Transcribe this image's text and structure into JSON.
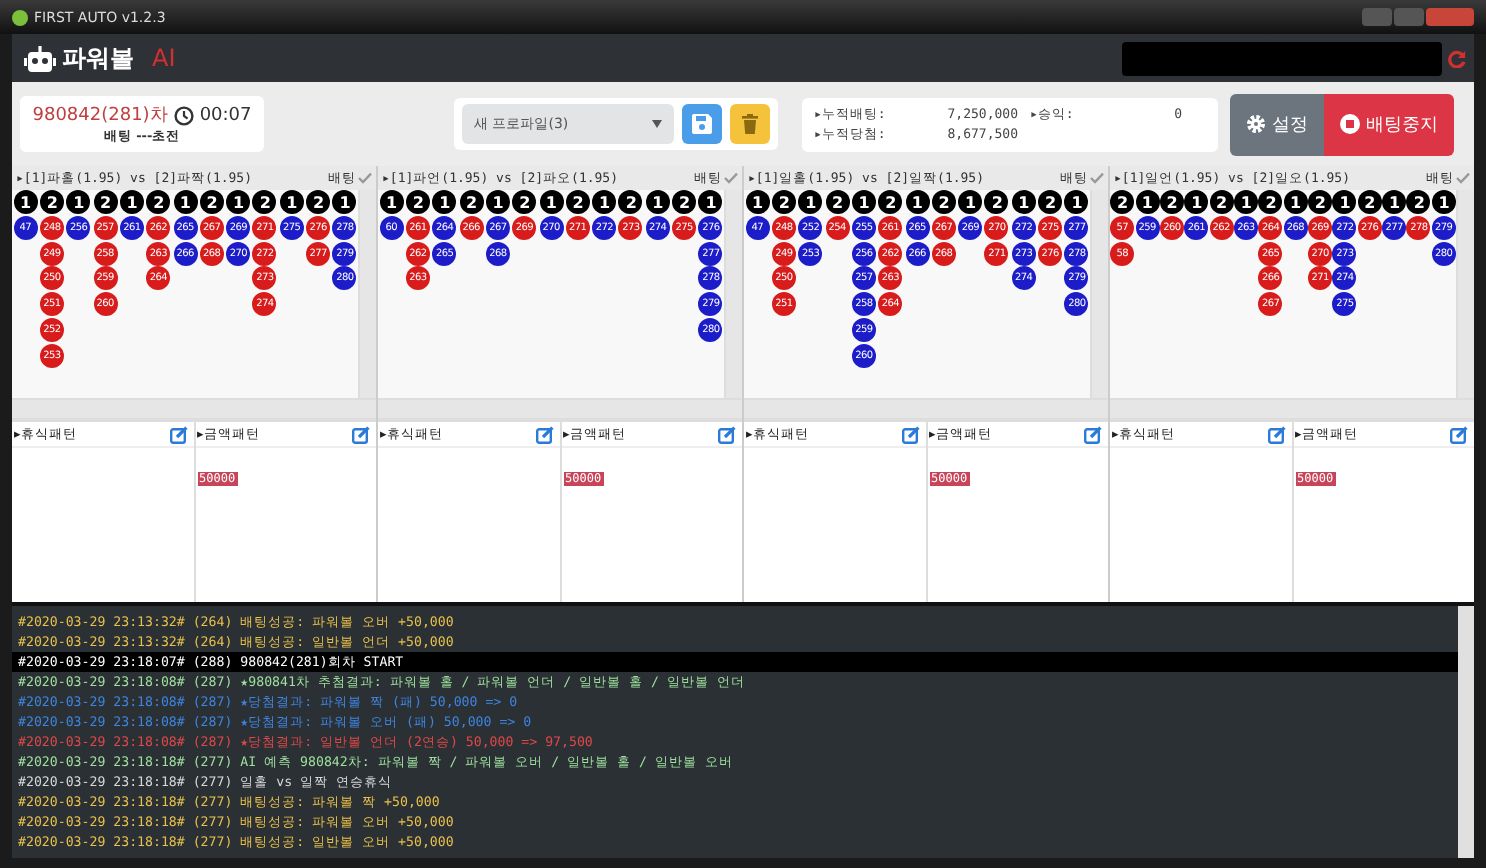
{
  "window": {
    "title": "FIRST AUTO v1.2.3"
  },
  "app": {
    "name": "파워볼",
    "badge": "AI"
  },
  "round": {
    "label": "980842(281)차",
    "timer": "00:07",
    "status": "배팅 ---초전"
  },
  "profile": {
    "value": "새 프로파일(3)"
  },
  "stats": [
    {
      "label": "▸누적배팅:",
      "value": "7,250,000"
    },
    {
      "label": "▸승익:",
      "value": "0"
    },
    {
      "label": "▸누적당첨:",
      "value": "8,677,500"
    }
  ],
  "buttons": [
    {
      "label": "설정",
      "kind": "settings"
    },
    {
      "label": "배팅중지",
      "kind": "stop"
    }
  ],
  "boards": [
    {
      "title": "▸[1]파홀(1.95) vs [2]파짝(1.95)",
      "bet": "배팅",
      "checked": true,
      "columns": [
        {
          "head": "1",
          "color": "#1c1cc8",
          "balls": [
            "47"
          ]
        },
        {
          "head": "2",
          "color": "#d81c1c",
          "balls": [
            "248",
            "249",
            "250",
            "251",
            "252",
            "253"
          ]
        },
        {
          "head": "1",
          "color": "#1c1cc8",
          "balls": [
            "256"
          ]
        },
        {
          "head": "2",
          "color": "#d81c1c",
          "balls": [
            "257",
            "258",
            "259",
            "260"
          ]
        },
        {
          "head": "1",
          "color": "#1c1cc8",
          "balls": [
            "261"
          ]
        },
        {
          "head": "2",
          "color": "#d81c1c",
          "balls": [
            "262",
            "263",
            "264"
          ]
        },
        {
          "head": "1",
          "color": "#1c1cc8",
          "balls": [
            "265",
            "266"
          ]
        },
        {
          "head": "2",
          "color": "#d81c1c",
          "balls": [
            "267",
            "268"
          ]
        },
        {
          "head": "1",
          "color": "#1c1cc8",
          "balls": [
            "269",
            "270"
          ]
        },
        {
          "head": "2",
          "color": "#d81c1c",
          "balls": [
            "271",
            "272",
            "273",
            "274"
          ]
        },
        {
          "head": "1",
          "color": "#1c1cc8",
          "balls": [
            "275"
          ]
        },
        {
          "head": "2",
          "color": "#d81c1c",
          "balls": [
            "276",
            "277"
          ]
        },
        {
          "head": "1",
          "color": "#1c1cc8",
          "balls": [
            "278",
            "279",
            "280"
          ]
        }
      ]
    },
    {
      "title": "▸[1]파언(1.95) vs [2]파오(1.95)",
      "bet": "배팅",
      "checked": true,
      "columns": [
        {
          "head": "1",
          "color": "#1c1cc8",
          "balls": [
            "60"
          ]
        },
        {
          "head": "2",
          "color": "#d81c1c",
          "balls": [
            "261",
            "262",
            "263"
          ]
        },
        {
          "head": "1",
          "color": "#1c1cc8",
          "balls": [
            "264",
            "265"
          ]
        },
        {
          "head": "2",
          "color": "#d81c1c",
          "balls": [
            "266"
          ]
        },
        {
          "head": "1",
          "color": "#1c1cc8",
          "balls": [
            "267",
            "268"
          ]
        },
        {
          "head": "2",
          "color": "#d81c1c",
          "balls": [
            "269"
          ]
        },
        {
          "head": "1",
          "color": "#1c1cc8",
          "balls": [
            "270"
          ]
        },
        {
          "head": "2",
          "color": "#d81c1c",
          "balls": [
            "271"
          ]
        },
        {
          "head": "1",
          "color": "#1c1cc8",
          "balls": [
            "272"
          ]
        },
        {
          "head": "2",
          "color": "#d81c1c",
          "balls": [
            "273"
          ]
        },
        {
          "head": "1",
          "color": "#1c1cc8",
          "balls": [
            "274"
          ]
        },
        {
          "head": "2",
          "color": "#d81c1c",
          "balls": [
            "275"
          ]
        },
        {
          "head": "1",
          "color": "#1c1cc8",
          "balls": [
            "276",
            "277",
            "278",
            "279",
            "280"
          ]
        }
      ]
    },
    {
      "title": "▸[1]일홀(1.95) vs [2]일짝(1.95)",
      "bet": "배팅",
      "checked": true,
      "columns": [
        {
          "head": "1",
          "color": "#1c1cc8",
          "balls": [
            "47"
          ]
        },
        {
          "head": "2",
          "color": "#d81c1c",
          "balls": [
            "248",
            "249",
            "250",
            "251"
          ]
        },
        {
          "head": "1",
          "color": "#1c1cc8",
          "balls": [
            "252",
            "253"
          ]
        },
        {
          "head": "2",
          "color": "#d81c1c",
          "balls": [
            "254"
          ]
        },
        {
          "head": "1",
          "color": "#1c1cc8",
          "balls": [
            "255",
            "256",
            "257",
            "258",
            "259",
            "260"
          ]
        },
        {
          "head": "2",
          "color": "#d81c1c",
          "balls": [
            "261",
            "262",
            "263",
            "264"
          ]
        },
        {
          "head": "1",
          "color": "#1c1cc8",
          "balls": [
            "265",
            "266"
          ]
        },
        {
          "head": "2",
          "color": "#d81c1c",
          "balls": [
            "267",
            "268"
          ]
        },
        {
          "head": "1",
          "color": "#1c1cc8",
          "balls": [
            "269"
          ]
        },
        {
          "head": "2",
          "color": "#d81c1c",
          "balls": [
            "270",
            "271"
          ]
        },
        {
          "head": "1",
          "color": "#1c1cc8",
          "balls": [
            "272",
            "273",
            "274"
          ]
        },
        {
          "head": "2",
          "color": "#d81c1c",
          "balls": [
            "275",
            "276"
          ]
        },
        {
          "head": "1",
          "color": "#1c1cc8",
          "balls": [
            "277",
            "278",
            "279",
            "280"
          ]
        }
      ]
    },
    {
      "title": "▸[1]일언(1.95) vs [2]일오(1.95)",
      "bet": "배팅",
      "checked": true,
      "columns": [
        {
          "head": "2",
          "color": "#d81c1c",
          "balls": [
            "57",
            "58"
          ]
        },
        {
          "head": "1",
          "color": "#1c1cc8",
          "balls": [
            "259"
          ]
        },
        {
          "head": "2",
          "color": "#d81c1c",
          "balls": [
            "260"
          ]
        },
        {
          "head": "1",
          "color": "#1c1cc8",
          "balls": [
            "261"
          ]
        },
        {
          "head": "2",
          "color": "#d81c1c",
          "balls": [
            "262"
          ]
        },
        {
          "head": "1",
          "color": "#1c1cc8",
          "balls": [
            "263"
          ]
        },
        {
          "head": "2",
          "color": "#d81c1c",
          "balls": [
            "264",
            "265",
            "266",
            "267"
          ]
        },
        {
          "head": "1",
          "color": "#1c1cc8",
          "balls": [
            "268"
          ]
        },
        {
          "head": "2",
          "color": "#d81c1c",
          "balls": [
            "269",
            "270",
            "271"
          ]
        },
        {
          "head": "1",
          "color": "#1c1cc8",
          "balls": [
            "272",
            "273",
            "274",
            "275"
          ]
        },
        {
          "head": "2",
          "color": "#d81c1c",
          "balls": [
            "276"
          ]
        },
        {
          "head": "1",
          "color": "#1c1cc8",
          "balls": [
            "277"
          ]
        },
        {
          "head": "2",
          "color": "#d81c1c",
          "balls": [
            "278"
          ]
        },
        {
          "head": "1",
          "color": "#1c1cc8",
          "balls": [
            "279",
            "280"
          ]
        }
      ]
    }
  ],
  "patterns": [
    {
      "rest": "▸휴식패턴",
      "amount": "▸금액패턴",
      "tags": [
        "50000"
      ]
    },
    {
      "rest": "▸휴식패턴",
      "amount": "▸금액패턴",
      "tags": [
        "50000"
      ]
    },
    {
      "rest": "▸휴식패턴",
      "amount": "▸금액패턴",
      "tags": [
        "50000"
      ]
    },
    {
      "rest": "▸휴식패턴",
      "amount": "▸금액패턴",
      "tags": [
        "50000"
      ]
    }
  ],
  "log": [
    {
      "text": "#2020-03-29 23:13:32# (264) 배팅성공: 파워볼 오버 +50,000",
      "color": "#e8c04a",
      "selected": false
    },
    {
      "text": "#2020-03-29 23:13:32# (264) 배팅성공: 일반볼 언더 +50,000",
      "color": "#e8c04a",
      "selected": false
    },
    {
      "text": "#2020-03-29 23:18:07# (288) 980842(281)회차 START",
      "color": "#ffffff",
      "selected": true
    },
    {
      "text": "#2020-03-29 23:18:08# (287) ★980841차 추첨결과: 파워볼 홀 / 파워볼 언더 / 일반볼 홀 / 일반볼 언더",
      "color": "#9ee09e",
      "selected": false
    },
    {
      "text": "#2020-03-29 23:18:08# (287) ★당첨결과: 파워볼 짝 (패) 50,000 => 0",
      "color": "#3d85e0",
      "selected": false
    },
    {
      "text": "#2020-03-29 23:18:08# (287) ★당첨결과: 파워볼 오버 (패) 50,000 => 0",
      "color": "#3d85e0",
      "selected": false
    },
    {
      "text": "#2020-03-29 23:18:08# (287) ★당첨결과: 일반볼 언더 (2연승) 50,000 => 97,500",
      "color": "#e04848",
      "selected": false
    },
    {
      "text": "#2020-03-29 23:18:18# (277) AI 예측 980842차: 파워볼 짝 / 파워볼 오버 / 일반볼 홀 / 일반볼 오버",
      "color": "#9ee09e",
      "selected": false
    },
    {
      "text": "#2020-03-29 23:18:18# (277) 일홀 vs 일짝 연승휴식",
      "color": "#d8d8d8",
      "selected": false
    },
    {
      "text": "#2020-03-29 23:18:18# (277) 배팅성공: 파워볼 짝 +50,000",
      "color": "#e8c04a",
      "selected": false
    },
    {
      "text": "#2020-03-29 23:18:18# (277) 배팅성공: 파워볼 오버 +50,000",
      "color": "#e8c04a",
      "selected": false
    },
    {
      "text": "#2020-03-29 23:18:18# (277) 배팅성공: 일반볼 오버 +50,000",
      "color": "#e8c04a",
      "selected": false
    }
  ]
}
